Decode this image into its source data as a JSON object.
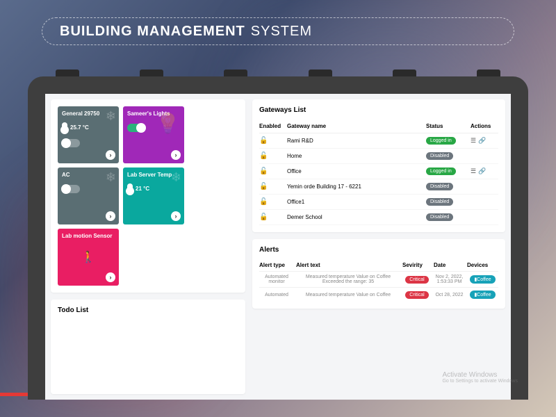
{
  "header": {
    "title_bold": "BUILDING MANAGEMENT",
    "title_light": "SYSTEM"
  },
  "tiles": [
    {
      "name": "General 29750",
      "temp": "25.7 °C",
      "color": "slate",
      "icon": "snow",
      "toggle": "off"
    },
    {
      "name": "Sameer's Lights",
      "color": "purple",
      "icon": "bulb",
      "toggle": "on"
    },
    {
      "name": "AC",
      "color": "slate",
      "icon": "snow",
      "toggle": "off"
    },
    {
      "name": "Lab Server Temp",
      "temp": "21 °C",
      "color": "teal",
      "icon": "snow"
    },
    {
      "name": "Lab motion Sensor",
      "color": "pink",
      "icon": "person"
    }
  ],
  "todo": {
    "title": "Todo List"
  },
  "gateways": {
    "title": "Gateways List",
    "cols": {
      "enabled": "Enabled",
      "name": "Gateway name",
      "status": "Status",
      "actions": "Actions"
    },
    "rows": [
      {
        "name": "Rami R&D",
        "status": "Logged in",
        "status_class": "green",
        "actions": true
      },
      {
        "name": "Home",
        "status": "Disabled",
        "status_class": "gray",
        "actions": false
      },
      {
        "name": "Office",
        "status": "Logged in",
        "status_class": "green",
        "actions": true
      },
      {
        "name": "Yemin orde Building 17 - 6221",
        "status": "Disabled",
        "status_class": "gray",
        "actions": false
      },
      {
        "name": "Office1",
        "status": "Disabled",
        "status_class": "gray",
        "actions": false
      },
      {
        "name": "Demer School",
        "status": "Disabled",
        "status_class": "gray",
        "actions": false
      }
    ]
  },
  "alerts": {
    "title": "Alerts",
    "cols": {
      "type": "Alert type",
      "text": "Alert text",
      "sev": "Sevirity",
      "date": "Date",
      "dev": "Devices"
    },
    "rows": [
      {
        "type": "Automated monitor",
        "text": "Measured temperature Value on Coffee Exceeded the range: 35",
        "sev": "Critical",
        "date": "Nov 2, 2022, 1:53:33 PM",
        "dev": "Coffee"
      },
      {
        "type": "Automated",
        "text": "Measured temperature Value on Coffee",
        "sev": "Critical",
        "date": "Oct 28, 2022",
        "dev": "Coffee"
      }
    ]
  },
  "watermark": {
    "line1": "Activate Windows",
    "line2": "Go to Settings to activate Windows"
  }
}
